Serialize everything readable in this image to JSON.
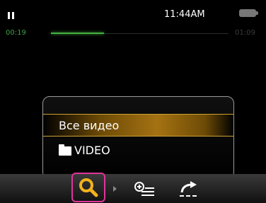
{
  "status": {
    "time": "11:44AM",
    "battery_icon": "battery-icon"
  },
  "playback": {
    "elapsed": "00:19",
    "total": "01:09",
    "progress": 0.3
  },
  "menu": {
    "items": [
      {
        "label": "Все видео",
        "selected": true
      },
      {
        "label": "VIDEO",
        "icon": "folder-icon"
      }
    ]
  },
  "toolbar": {
    "search_icon": "search-icon",
    "add_icon": "add-to-list-icon",
    "share_icon": "share-icon",
    "highlight_color": "#e0349a"
  }
}
